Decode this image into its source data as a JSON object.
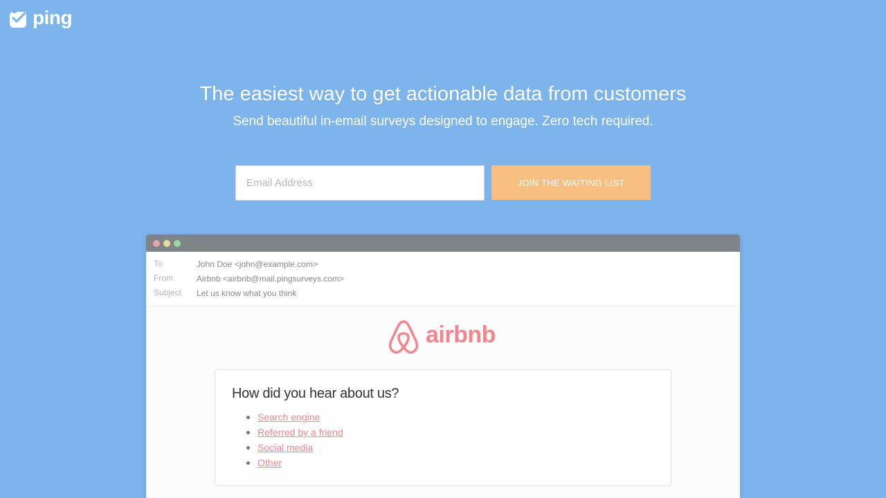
{
  "brand": {
    "name": "ping",
    "icon": "ping-logo-icon",
    "color": "#ffffff"
  },
  "hero": {
    "title": "The easiest way to get actionable data from customers",
    "subtitle": "Send beautiful in-email surveys designed to engage. Zero tech required."
  },
  "signup": {
    "email_placeholder": "Email Address",
    "button_label": "JOIN THE WAITING LIST",
    "button_color": "#f9bf81"
  },
  "email": {
    "headers": [
      {
        "label": "To",
        "value": "John Doe <john@example.com>"
      },
      {
        "label": "From",
        "value": "Airbnb <airbnb@mail.pingsurveys.com>"
      },
      {
        "label": "Subject",
        "value": "Let us know what you think"
      }
    ],
    "sender_brand": {
      "name": "airbnb",
      "icon": "airbnb-logo-icon",
      "color": "#f5858d"
    },
    "survey": {
      "question": "How did you hear about us?",
      "options": [
        "Search engine",
        "Referred by a friend",
        "Social media",
        "Other"
      ]
    }
  },
  "colors": {
    "background": "#7db4ec",
    "titlebar": "#7f8486"
  }
}
